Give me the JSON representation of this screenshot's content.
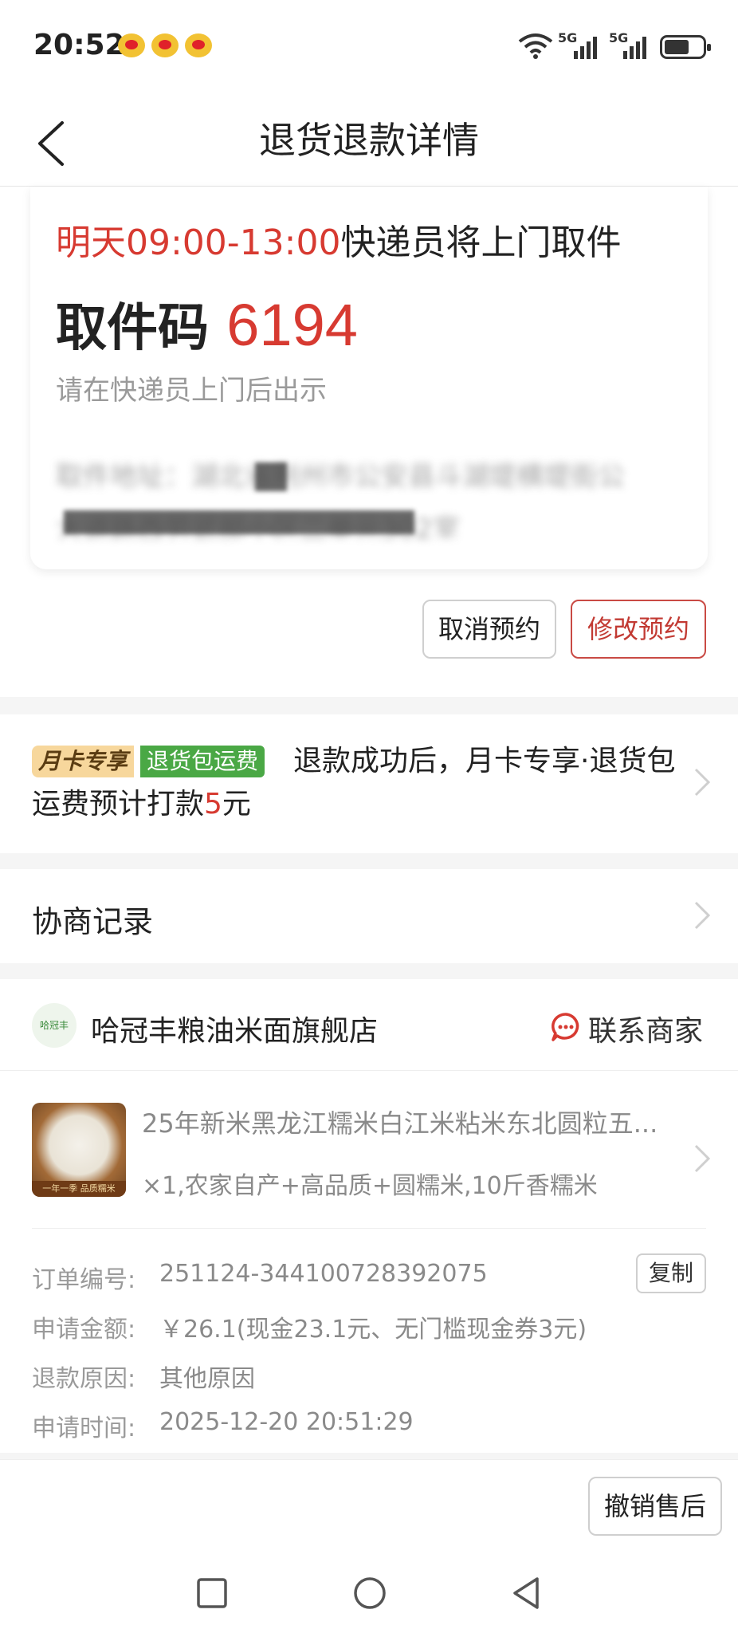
{
  "status_bar": {
    "time": "20:52",
    "network_1": "5G",
    "network_2": "5G",
    "icons": [
      "weibo-icon",
      "weibo-icon",
      "weibo-icon",
      "wifi-icon",
      "signal-icon",
      "signal-icon",
      "battery-icon"
    ],
    "battery_level": 0.6
  },
  "header": {
    "title": "退货退款详情",
    "back_icon": "chevron-left-icon"
  },
  "pickup": {
    "time_highlight": "明天09:00-13:00",
    "time_suffix": "快递员将上门取件",
    "code_label": "取件码",
    "code_value": "6194",
    "hint": "请在快递员上门后出示",
    "address_line1": "取件地址：湖北省荆州市公安县斗湖堤横堤街公",
    "address_line2": "大道路西劳武部小区二单元302室",
    "cancel_label": "取消预约",
    "modify_label": "修改预约"
  },
  "monthly_card": {
    "tag_1": "月卡专享",
    "tag_2": "退货包运费",
    "text_before": "退款成功后，月卡专享·退货包运费预计打款",
    "amount": "5",
    "text_after": "元"
  },
  "negotiation": {
    "label": "协商记录"
  },
  "shop": {
    "logo_text": "哈冠丰",
    "name": "哈冠丰粮油米面旗舰店",
    "contact_label": "联系商家"
  },
  "product": {
    "image_band": "一年一季 品质糯米",
    "title": "25年新米黑龙江糯米白江米粘米东北圆粒五...",
    "spec": "×1,农家自产+高品质+圆糯米,10斤香糯米"
  },
  "order_info": {
    "order_no_label": "订单编号:",
    "order_no": "251124-344100728392075",
    "copy_label": "复制",
    "amount_label": "申请金额:",
    "amount": "￥26.1(现金23.1元、无门槛现金券3元)",
    "reason_label": "退款原因:",
    "reason": "其他原因",
    "time_label": "申请时间:",
    "time": "2025-12-20 20:51:29"
  },
  "bottom": {
    "revoke_label": "撤销售后"
  },
  "colors": {
    "accent_red": "#d73a31",
    "tag_gold": "#f7d79c",
    "tag_green": "#4aa845"
  }
}
